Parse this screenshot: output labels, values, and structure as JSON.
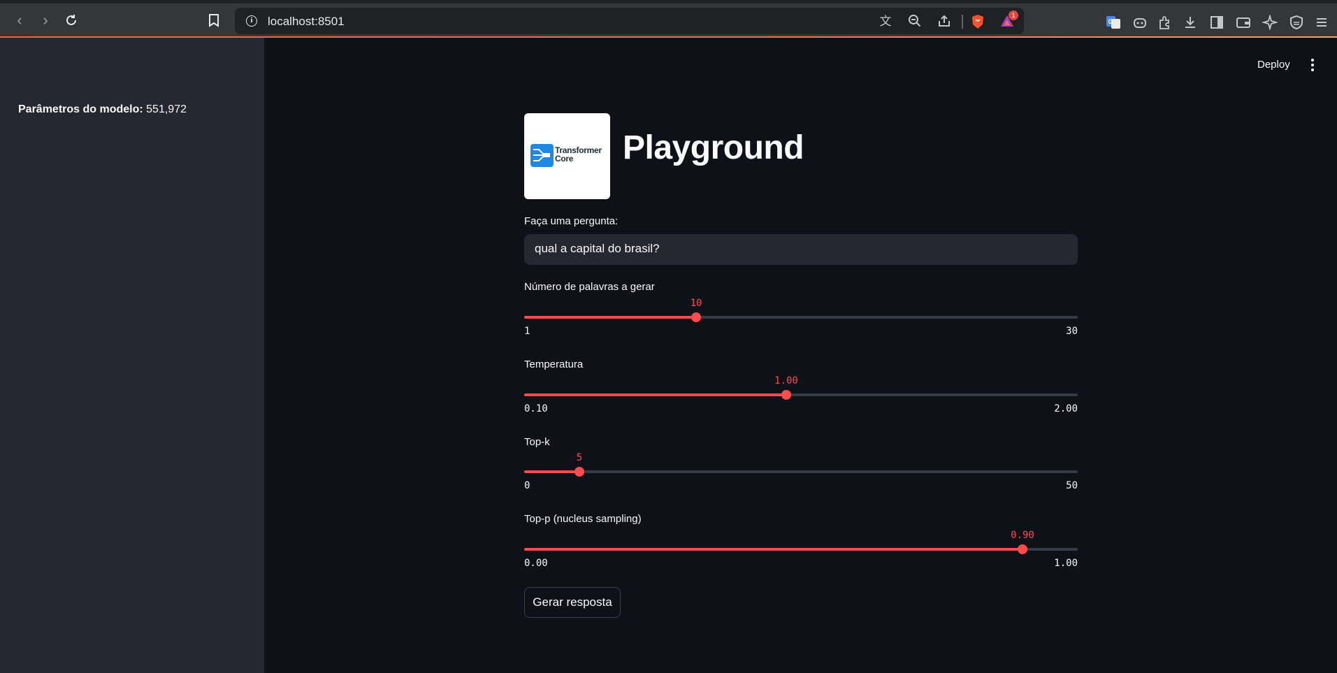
{
  "browser": {
    "url": "localhost:8501",
    "notification_count": "1",
    "icons": [
      "back-icon",
      "forward-icon",
      "reload-icon",
      "bookmark-icon",
      "translate-icon",
      "zoom-out-icon",
      "share-icon",
      "brave-shield-icon",
      "brave-rewards-icon",
      "google-translate-ext-icon",
      "copilot-ext-icon",
      "extensions-icon",
      "downloads-icon",
      "sidebar-icon",
      "wallet-icon",
      "leo-ai-icon",
      "vpn-icon",
      "menu-icon"
    ]
  },
  "sidebar": {
    "params_label": "Parâmetros do modelo:",
    "params_value": "551,972"
  },
  "header": {
    "deploy_label": "Deploy",
    "logo_text_line1": "Transformer",
    "logo_text_line2": "Core",
    "title": "Playground"
  },
  "question": {
    "label": "Faça uma pergunta:",
    "value": "qual a capital do brasil?"
  },
  "sliders": [
    {
      "label": "Número de palavras a gerar",
      "value": "10",
      "min": "1",
      "max": "30",
      "fraction": 0.31
    },
    {
      "label": "Temperatura",
      "value": "1.00",
      "min": "0.10",
      "max": "2.00",
      "fraction": 0.474
    },
    {
      "label": "Top-k",
      "value": "5",
      "min": "0",
      "max": "50",
      "fraction": 0.1
    },
    {
      "label": "Top-p (nucleus sampling)",
      "value": "0.90",
      "min": "0.00",
      "max": "1.00",
      "fraction": 0.9
    }
  ],
  "submit": {
    "label": "Gerar resposta"
  },
  "colors": {
    "accent": "#ff4b4b",
    "background": "#0e1117",
    "sidebar": "#262730"
  }
}
